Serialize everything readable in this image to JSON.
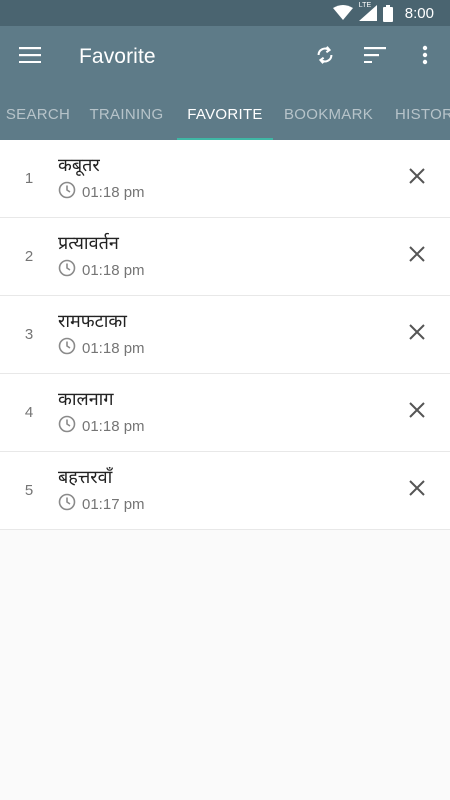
{
  "status_bar": {
    "time": "8:00",
    "network": "LTE"
  },
  "app_bar": {
    "title": "Favorite",
    "actions": [
      "menu-icon",
      "refresh-icon",
      "sort-icon",
      "more-vert-icon"
    ]
  },
  "tabs": [
    {
      "label": "SEARCH",
      "active": false
    },
    {
      "label": "TRAINING",
      "active": false
    },
    {
      "label": "FAVORITE",
      "active": true
    },
    {
      "label": "BOOKMARK",
      "active": false
    },
    {
      "label": "HISTORY",
      "active": false
    }
  ],
  "favorites": [
    {
      "index": "1",
      "word": "कबूतर",
      "time": "01:18 pm"
    },
    {
      "index": "2",
      "word": "प्रत्यावर्तन",
      "time": "01:18 pm"
    },
    {
      "index": "3",
      "word": "रामफटाका",
      "time": "01:18 pm"
    },
    {
      "index": "4",
      "word": "कालनाग",
      "time": "01:18 pm"
    },
    {
      "index": "5",
      "word": "बहत्तरवाँ",
      "time": "01:17 pm"
    }
  ],
  "colors": {
    "app_bar": "#5e7b88",
    "status_bar": "#4a6470",
    "indicator": "#3fb7a5"
  }
}
